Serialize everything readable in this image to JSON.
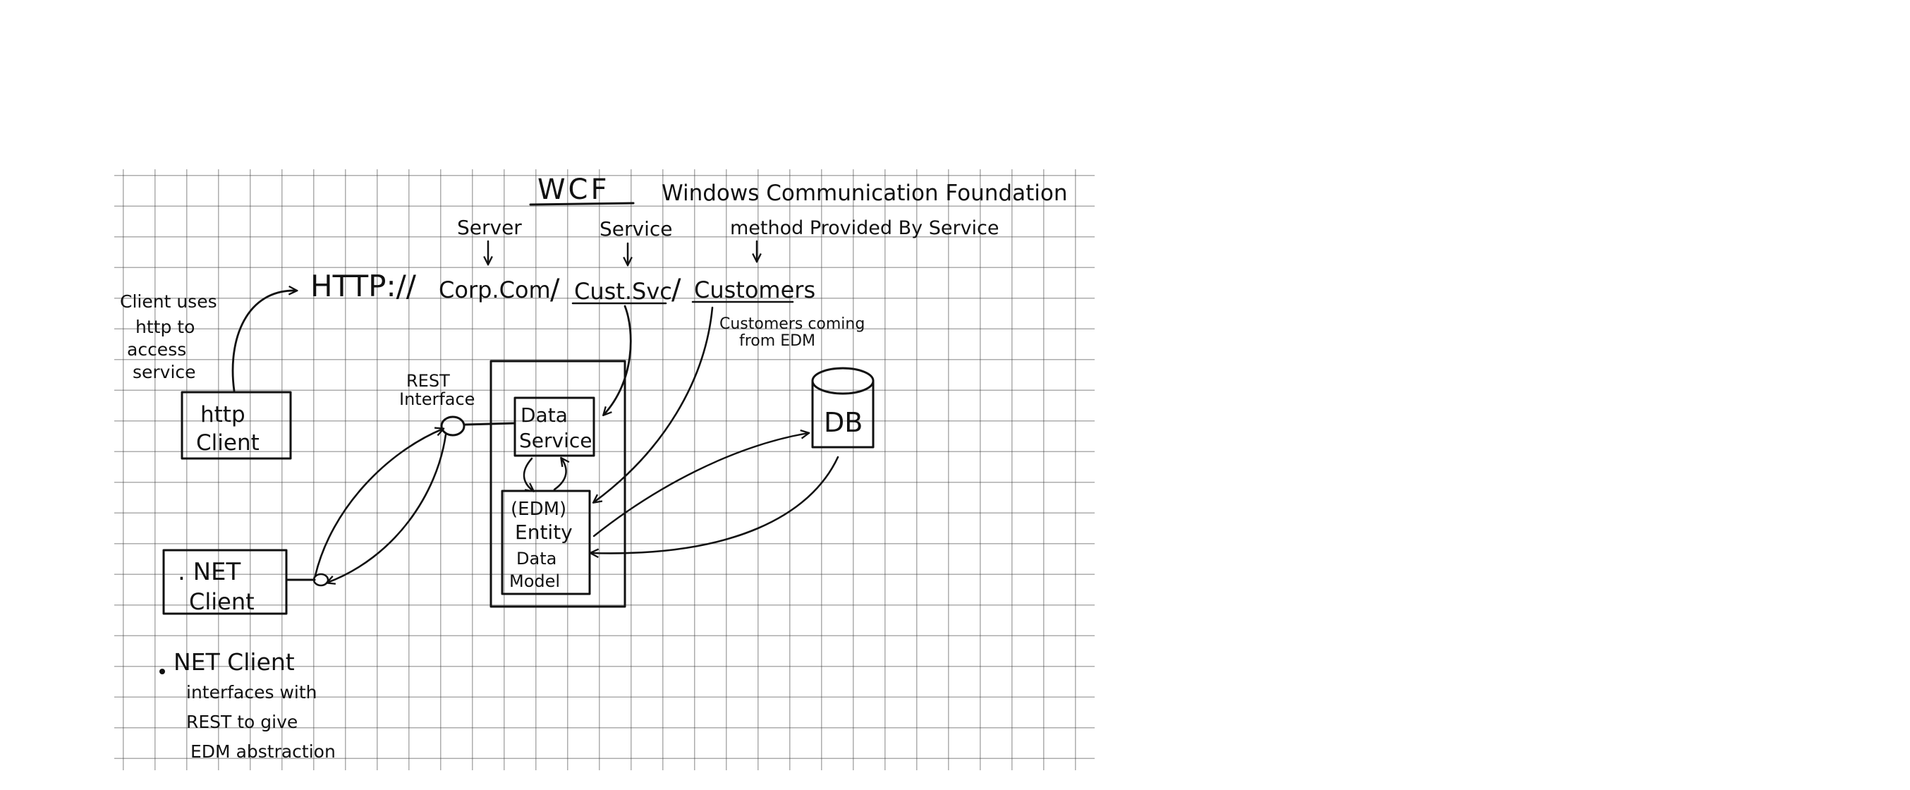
{
  "title": {
    "acronym": "WCF",
    "expansion": "Windows Communication Foundation"
  },
  "url": {
    "protocol": "HTTP://",
    "server": "Corp.Com",
    "separator": "/",
    "service": "Cust.Svc",
    "method": "Customers"
  },
  "url_labels": {
    "server": "Server",
    "service": "Service",
    "method": "method Provided By Service"
  },
  "notes": {
    "client_uses": [
      "Client uses",
      "http to",
      "access",
      "service"
    ],
    "customers_coming": [
      "Customers coming",
      "from EDM"
    ],
    "rest_interface": [
      "REST",
      "Interface"
    ],
    "net_client_note": [
      "NET Client",
      "interfaces with",
      "REST to give",
      "EDM abstraction"
    ]
  },
  "nodes": {
    "http_client": [
      "http",
      "Client"
    ],
    "net_client": [
      ". NET",
      "Client"
    ],
    "data_service": [
      "Data",
      "Service"
    ],
    "entity_data_model": [
      "(EDM)",
      "Entity",
      "Data",
      "Model"
    ],
    "db": "DB"
  },
  "colors": {
    "ink": "#111111",
    "grid": "#6b6b6b",
    "paper": "#ffffff"
  }
}
